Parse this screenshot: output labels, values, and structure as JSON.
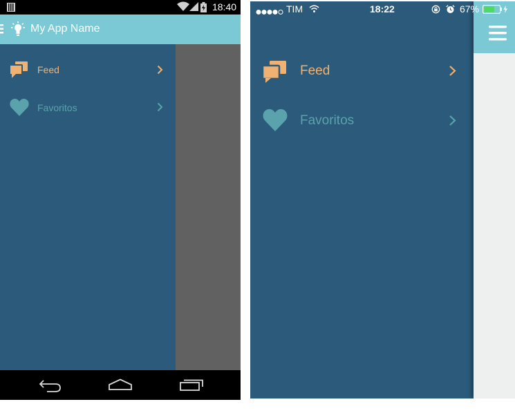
{
  "colors": {
    "drawer_bg": "#2b5a7b",
    "app_bar": "#7bc9d4",
    "feed_accent": "#f0b171",
    "favoritos_accent": "#5aa3ad",
    "scrim": "#616161",
    "content_bg": "#edf0ef"
  },
  "android": {
    "status_bar": {
      "time": "18:40",
      "icons": [
        "sim-icon",
        "wifi-icon",
        "signal-icon",
        "battery-charging-icon"
      ]
    },
    "app_bar": {
      "title": "My App Name",
      "icons": [
        "menu-icon",
        "lightbulb-icon"
      ]
    },
    "menu": [
      {
        "label": "Feed",
        "icon": "chat-bubbles-icon",
        "active": true
      },
      {
        "label": "Favoritos",
        "icon": "heart-icon",
        "active": false
      }
    ],
    "nav_bar": {
      "icons": [
        "back-icon",
        "home-icon",
        "recent-apps-icon"
      ]
    }
  },
  "ios": {
    "status_bar": {
      "carrier": "●●●●○ TIM",
      "carrier_name": "TIM",
      "time": "18:22",
      "battery": "67%",
      "icons": [
        "signal-dots-icon",
        "wifi-icon",
        "rotation-lock-icon",
        "alarm-icon",
        "battery-charging-icon"
      ]
    },
    "menu": [
      {
        "label": "Feed",
        "icon": "chat-bubbles-icon",
        "active": true
      },
      {
        "label": "Favoritos",
        "icon": "heart-icon",
        "active": false
      }
    ],
    "header": {
      "icons": [
        "hamburger-icon"
      ]
    }
  }
}
